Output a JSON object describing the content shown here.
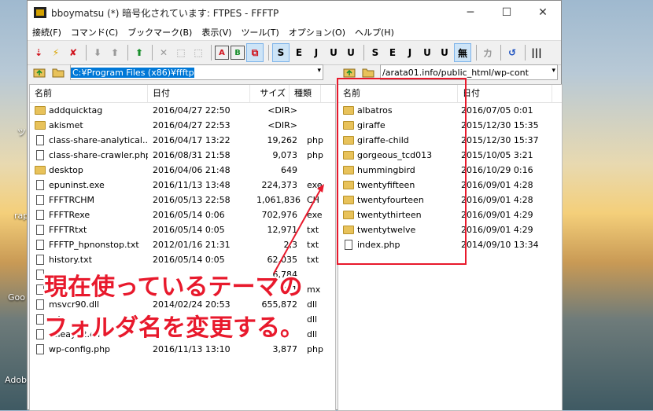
{
  "desktop": {
    "labels": [
      "ツ",
      "rap",
      "Goo",
      "Adob"
    ]
  },
  "window": {
    "title": "bboymatsu (*) 暗号化されています: FTPES - FFFTP",
    "controls": {
      "minimize": "─",
      "maximize": "☐",
      "close": "✕"
    }
  },
  "menu": [
    "接続(F)",
    "コマンド(C)",
    "ブックマーク(B)",
    "表示(V)",
    "ツール(T)",
    "オプション(O)",
    "ヘルプ(H)"
  ],
  "toolbar": {
    "buttons": [
      "⇣",
      "⚡",
      "✘",
      "⬇",
      "⬆",
      "⬆",
      "✕",
      "⬚",
      "⬚",
      "A",
      "B",
      "⧉",
      "S",
      "E",
      "J",
      "U",
      "U",
      "S",
      "E",
      "J",
      "U",
      "U",
      "無",
      "カ",
      "↺",
      "|||"
    ],
    "colors": {
      "red": "#d0141e",
      "green": "#1a8f2c",
      "gray": "#9a9a9a",
      "blue": "#1a4fbf"
    }
  },
  "local": {
    "path": "C:¥Program Files (x86)¥ffftp",
    "headers": {
      "name": "名前",
      "date": "日付",
      "size": "サイズ",
      "type": "種類"
    },
    "rows": [
      {
        "icon": "folder",
        "name": "addquicktag",
        "date": "2016/04/27 22:50",
        "size": "<DIR>",
        "type": ""
      },
      {
        "icon": "folder",
        "name": "akismet",
        "date": "2016/04/27 22:53",
        "size": "<DIR>",
        "type": ""
      },
      {
        "icon": "file",
        "name": "class-share-analytical...",
        "date": "2016/04/17 13:22",
        "size": "19,262",
        "type": "php"
      },
      {
        "icon": "file",
        "name": "class-share-crawler.php",
        "date": "2016/08/31 21:58",
        "size": "9,073",
        "type": "php"
      },
      {
        "icon": "folder",
        "name": "desktop",
        "date": "2016/04/06 21:48",
        "size": "649",
        "type": ""
      },
      {
        "icon": "file",
        "name": "epuninst.exe",
        "date": "2016/11/13 13:48",
        "size": "224,373",
        "type": "exe"
      },
      {
        "icon": "file",
        "name": "FFFTRCHM",
        "date": "2016/05/13 22:58",
        "size": "1,061,836",
        "type": "CH"
      },
      {
        "icon": "file",
        "name": "FFFTRexe",
        "date": "2016/05/14 0:06",
        "size": "702,976",
        "type": "exe"
      },
      {
        "icon": "file",
        "name": "FFFTRtxt",
        "date": "2016/05/14 0:05",
        "size": "12,971",
        "type": "txt"
      },
      {
        "icon": "file",
        "name": "FFFTP_hpnonstop.txt",
        "date": "2012/01/16 21:31",
        "size": "2,3",
        "type": "txt"
      },
      {
        "icon": "file",
        "name": "history.txt",
        "date": "2016/05/14 0:05",
        "size": "62,035",
        "type": "txt"
      },
      {
        "icon": "file",
        "name": "",
        "date": "",
        "size": "6,784",
        "type": ""
      },
      {
        "icon": "file",
        "name": "",
        "date": "",
        "size": "381",
        "type": "mx"
      },
      {
        "icon": "file",
        "name": "msvcr90.dll",
        "date": "2014/02/24 20:53",
        "size": "655,872",
        "type": "dll"
      },
      {
        "icon": "file",
        "name": "ssl",
        "date": "",
        "size": "",
        "type": "dll"
      },
      {
        "icon": "file",
        "name": "ssleay32.dll",
        "date": "",
        "size": "",
        "type": "dll"
      },
      {
        "icon": "file",
        "name": "wp-config.php",
        "date": "2016/11/13 13:10",
        "size": "3,877",
        "type": "php"
      }
    ]
  },
  "remote": {
    "path": "/arata01.info/public_html/wp-cont",
    "headers": {
      "name": "名前",
      "date": "日付"
    },
    "rows": [
      {
        "icon": "folder",
        "name": "albatros",
        "date": "2016/07/05 0:01"
      },
      {
        "icon": "folder",
        "name": "giraffe",
        "date": "2015/12/30 15:35"
      },
      {
        "icon": "folder",
        "name": "giraffe-child",
        "date": "2015/12/30 15:37"
      },
      {
        "icon": "folder",
        "name": "gorgeous_tcd013",
        "date": "2015/10/05 3:21"
      },
      {
        "icon": "folder",
        "name": "hummingbird",
        "date": "2016/10/29 0:16"
      },
      {
        "icon": "folder",
        "name": "twentyfifteen",
        "date": "2016/09/01 4:28"
      },
      {
        "icon": "folder",
        "name": "twentyfourteen",
        "date": "2016/09/01 4:28"
      },
      {
        "icon": "folder",
        "name": "twentythirteen",
        "date": "2016/09/01 4:29"
      },
      {
        "icon": "folder",
        "name": "twentytwelve",
        "date": "2016/09/01 4:29"
      },
      {
        "icon": "file",
        "name": "index.php",
        "date": "2014/09/10 13:34"
      }
    ]
  },
  "annotation": {
    "line1": "現在使っているテーマの",
    "line2": "フォルダ名を変更する。",
    "color": "#e8192c"
  }
}
